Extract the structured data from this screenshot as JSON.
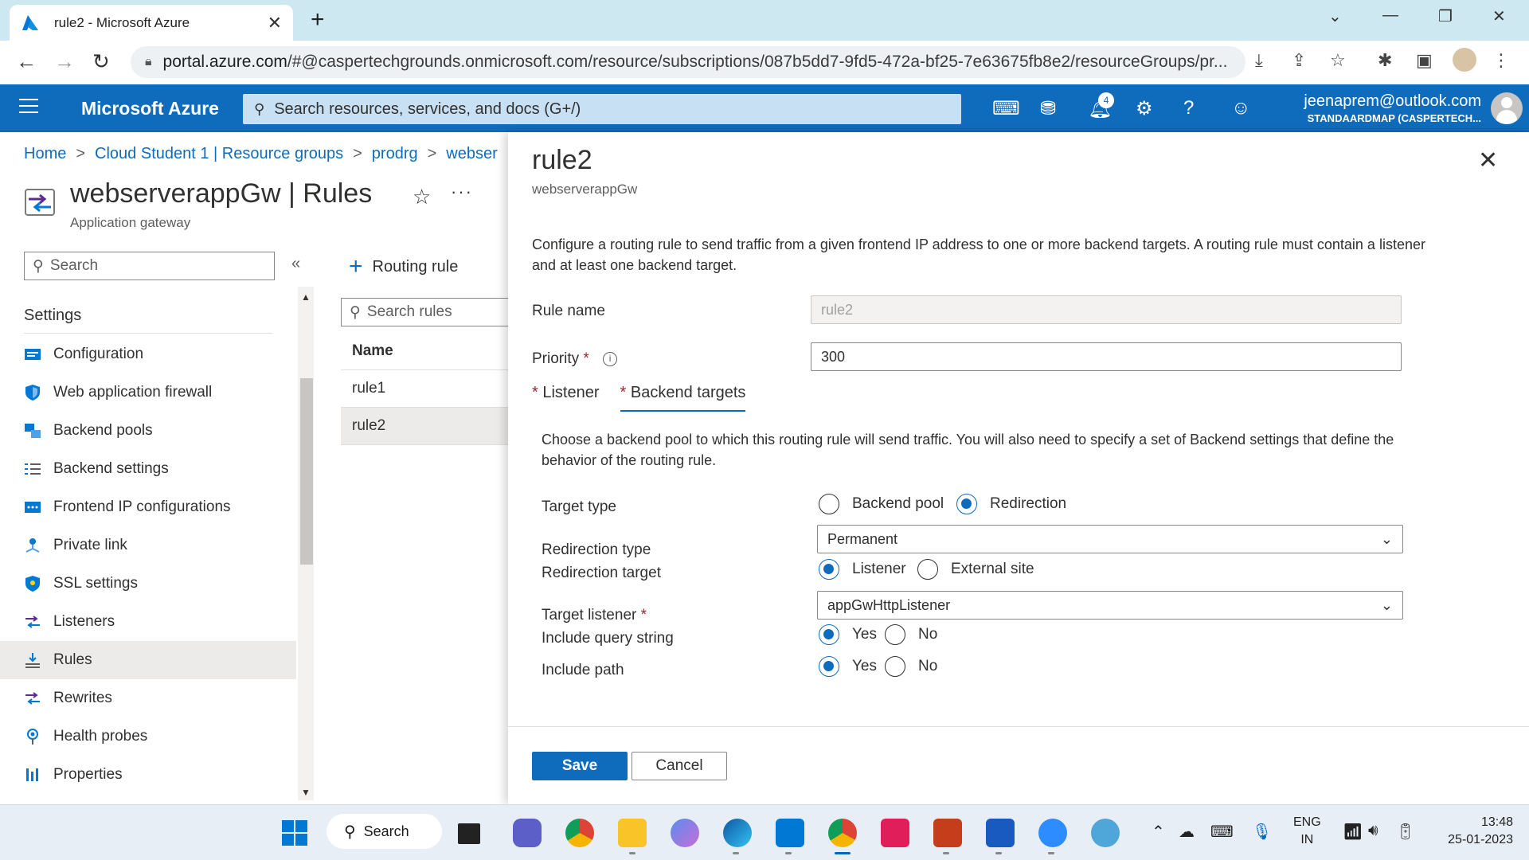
{
  "browser": {
    "tab_title": "rule2 - Microsoft Azure",
    "url_host": "portal.azure.com",
    "url_rest": "/#@caspertechgrounds.onmicrosoft.com/resource/subscriptions/087b5dd7-9fd5-472a-bf25-7e63675fb8e2/resourceGroups/pr..."
  },
  "header": {
    "brand": "Microsoft Azure",
    "search_placeholder": "Search resources, services, and docs (G+/)",
    "notification_count": "4",
    "user_email": "jeenaprem@outlook.com",
    "user_directory": "STANDAARDMAP (CASPERTECH..."
  },
  "breadcrumb": {
    "items": [
      "Home",
      "Cloud Student 1 | Resource groups",
      "prodrg",
      "webser"
    ]
  },
  "resource": {
    "title": "webserverappGw | Rules",
    "subtitle": "Application gateway"
  },
  "menu": {
    "search_placeholder": "Search",
    "section": "Settings",
    "items": [
      {
        "label": "Configuration",
        "icon": "configuration-icon"
      },
      {
        "label": "Web application firewall",
        "icon": "shield-icon"
      },
      {
        "label": "Backend pools",
        "icon": "backend-pools-icon"
      },
      {
        "label": "Backend settings",
        "icon": "list-settings-icon"
      },
      {
        "label": "Frontend IP configurations",
        "icon": "frontend-ip-icon"
      },
      {
        "label": "Private link",
        "icon": "private-link-icon"
      },
      {
        "label": "SSL settings",
        "icon": "ssl-shield-icon"
      },
      {
        "label": "Listeners",
        "icon": "listeners-icon"
      },
      {
        "label": "Rules",
        "icon": "rules-icon"
      },
      {
        "label": "Rewrites",
        "icon": "rewrites-icon"
      },
      {
        "label": "Health probes",
        "icon": "health-probe-icon"
      },
      {
        "label": "Properties",
        "icon": "properties-icon"
      }
    ],
    "selected": "Rules"
  },
  "rules_list": {
    "add_label": "Routing rule",
    "search_placeholder": "Search rules",
    "column_name": "Name",
    "rows": [
      "rule1",
      "rule2"
    ],
    "selected": "rule2"
  },
  "panel": {
    "title": "rule2",
    "subtitle": "webserverappGw",
    "description": "Configure a routing rule to send traffic from a given frontend IP address to one or more backend targets. A routing rule must contain a listener and at least one backend target.",
    "rule_name_label": "Rule name",
    "rule_name_value": "rule2",
    "priority_label": "Priority",
    "priority_value": "300",
    "tabs": [
      {
        "label": "Listener",
        "active": false
      },
      {
        "label": "Backend targets",
        "active": true
      }
    ],
    "backend_description": "Choose a backend pool to which this routing rule will send traffic. You will also need to specify a set of Backend settings that define the behavior of the routing rule.",
    "target_type_label": "Target type",
    "target_type_options": [
      "Backend pool",
      "Redirection"
    ],
    "target_type_selected": "Redirection",
    "redirection_type_label": "Redirection type",
    "redirection_type_value": "Permanent",
    "redirection_target_label": "Redirection target",
    "redirection_target_options": [
      "Listener",
      "External site"
    ],
    "redirection_target_selected": "Listener",
    "target_listener_label": "Target listener",
    "target_listener_value": "appGwHttpListener",
    "include_query_label": "Include query string",
    "include_query_options": [
      "Yes",
      "No"
    ],
    "include_query_selected": "Yes",
    "include_path_label": "Include path",
    "include_path_options": [
      "Yes",
      "No"
    ],
    "include_path_selected": "Yes",
    "save_label": "Save",
    "cancel_label": "Cancel",
    "required_mark": "*",
    "info_glyph": "i"
  },
  "taskbar": {
    "search_label": "Search",
    "lang_line1": "ENG",
    "lang_line2": "IN",
    "time": "13:48",
    "date": "25-01-2023"
  },
  "colors": {
    "azure_blue": "#0f6cbd",
    "tab_strip": "#cde8f1",
    "required_red": "#a4262c"
  }
}
